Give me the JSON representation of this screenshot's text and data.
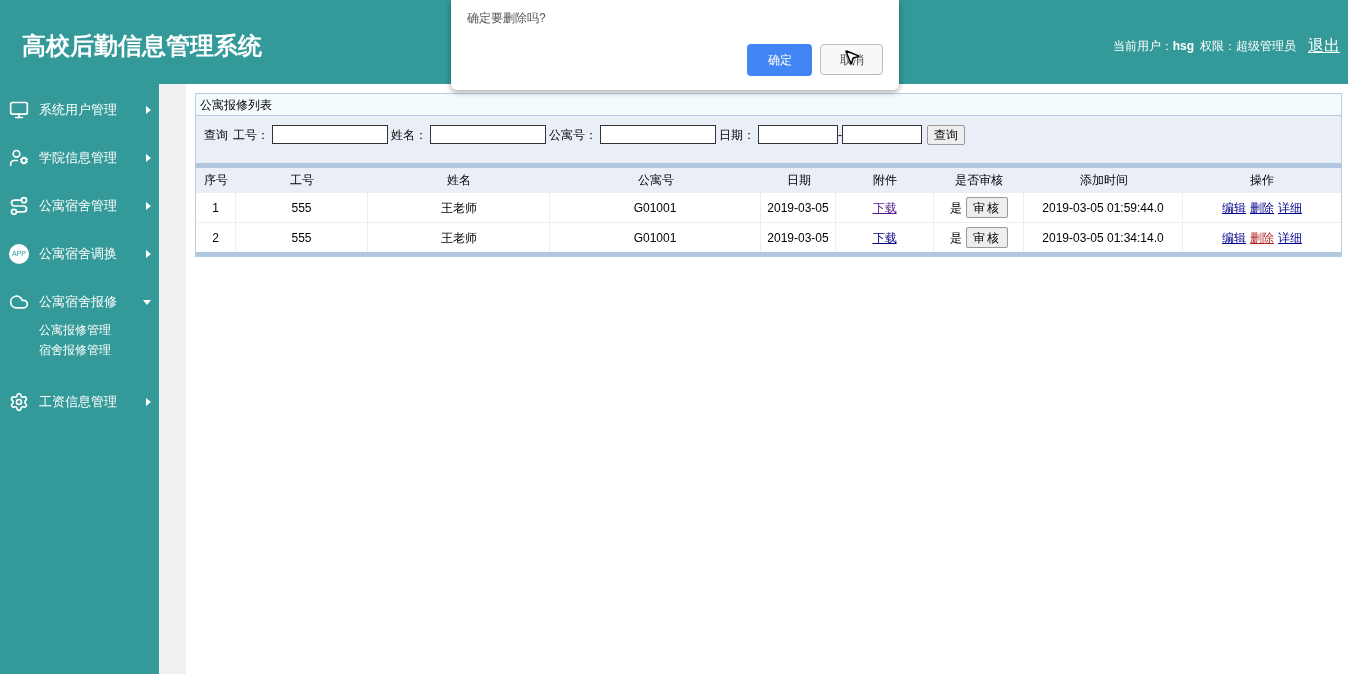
{
  "header": {
    "title": "高校后勤信息管理系统",
    "user_label": "当前用户：",
    "user": "hsg",
    "role_label": "权限：超级管理员",
    "logout": "退出"
  },
  "sidebar": {
    "items": [
      {
        "label": "系统用户管理",
        "expanded": false
      },
      {
        "label": "学院信息管理",
        "expanded": false
      },
      {
        "label": "公寓宿舍管理",
        "expanded": false
      },
      {
        "label": "公寓宿舍调换",
        "expanded": false,
        "icon_text": "APP"
      },
      {
        "label": "公寓宿舍报修",
        "expanded": true,
        "children": [
          {
            "label": "公寓报修管理"
          },
          {
            "label": "宿舍报修管理"
          }
        ]
      },
      {
        "label": "工资信息管理",
        "expanded": false
      }
    ]
  },
  "panel": {
    "title": "公寓报修列表",
    "search": {
      "prefix": "查询",
      "fields": [
        {
          "label": "工号："
        },
        {
          "label": "姓名："
        },
        {
          "label": "公寓号："
        },
        {
          "label": "日期："
        }
      ],
      "range_separator": "-",
      "button": "查询"
    },
    "table": {
      "columns": [
        "序号",
        "工号",
        "姓名",
        "公寓号",
        "日期",
        "附件",
        "是否审核",
        "添加时间",
        "操作"
      ],
      "rows": [
        {
          "no": "1",
          "staff_id": "555",
          "name": "王老师",
          "apartment": "G01001",
          "date": "2019-03-05",
          "attachment": {
            "label": "下载",
            "visited": true
          },
          "reviewed": "是",
          "review_button": "审核",
          "added": "2019-03-05 01:59:44.0",
          "actions": [
            {
              "label": "编辑",
              "active": false
            },
            {
              "label": "删除",
              "active": false
            },
            {
              "label": "详细",
              "active": false
            }
          ]
        },
        {
          "no": "2",
          "staff_id": "555",
          "name": "王老师",
          "apartment": "G01001",
          "date": "2019-03-05",
          "attachment": {
            "label": "下载",
            "visited": false
          },
          "reviewed": "是",
          "review_button": "审核",
          "added": "2019-03-05 01:34:14.0",
          "actions": [
            {
              "label": "编辑",
              "active": false
            },
            {
              "label": "删除",
              "active": true
            },
            {
              "label": "详细",
              "active": false
            }
          ]
        }
      ]
    }
  },
  "dialog": {
    "message": "确定要删除吗?",
    "buttons": [
      {
        "label": "确定",
        "kind": "primary"
      },
      {
        "label": "取消",
        "kind": "secondary"
      }
    ]
  }
}
